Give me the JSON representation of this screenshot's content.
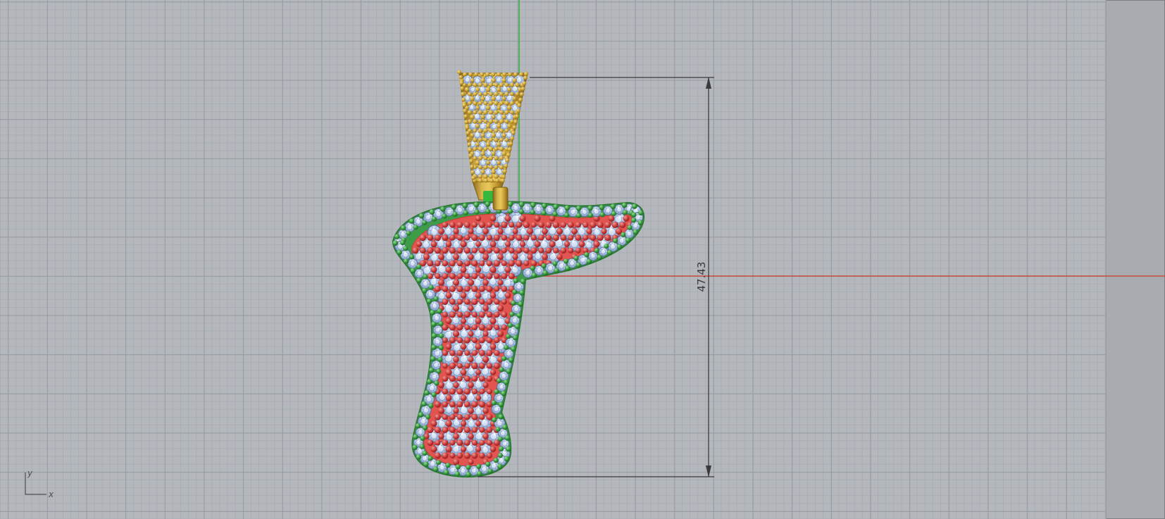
{
  "viewport": {
    "type": "cad-front-viewport",
    "grid_visible": true
  },
  "dimension": {
    "value": "47.43",
    "orientation": "vertical"
  },
  "axis_indicator": {
    "x_label": "x",
    "y_label": "y"
  },
  "pendant": {
    "letter": "T",
    "style": "script pave pendant",
    "parts": [
      "gold pave bail",
      "green stone border band",
      "red pave center"
    ]
  },
  "colors": {
    "background": "#a8abb0",
    "grid_background": "#b4b7bc",
    "grid_minor": "#a9adb4",
    "grid_major": "#979ba2",
    "y_axis": "#3cb043",
    "x_axis": "#cc4a44",
    "dimension": "#3a3a3d",
    "metal_green": "#3e9b48",
    "metal_green_dark": "#2c7a35",
    "metal_red": "#e2544f",
    "metal_red_dark": "#c4403c",
    "metal_gold": "#c9a033",
    "metal_gold_dark": "#7c5d14",
    "gem_blue": "#b6c9e6",
    "bead_green": "#2e8f35",
    "bead_red": "#c23432",
    "bead_gold": "#c79e2e",
    "connector_green": "#35b83d"
  }
}
